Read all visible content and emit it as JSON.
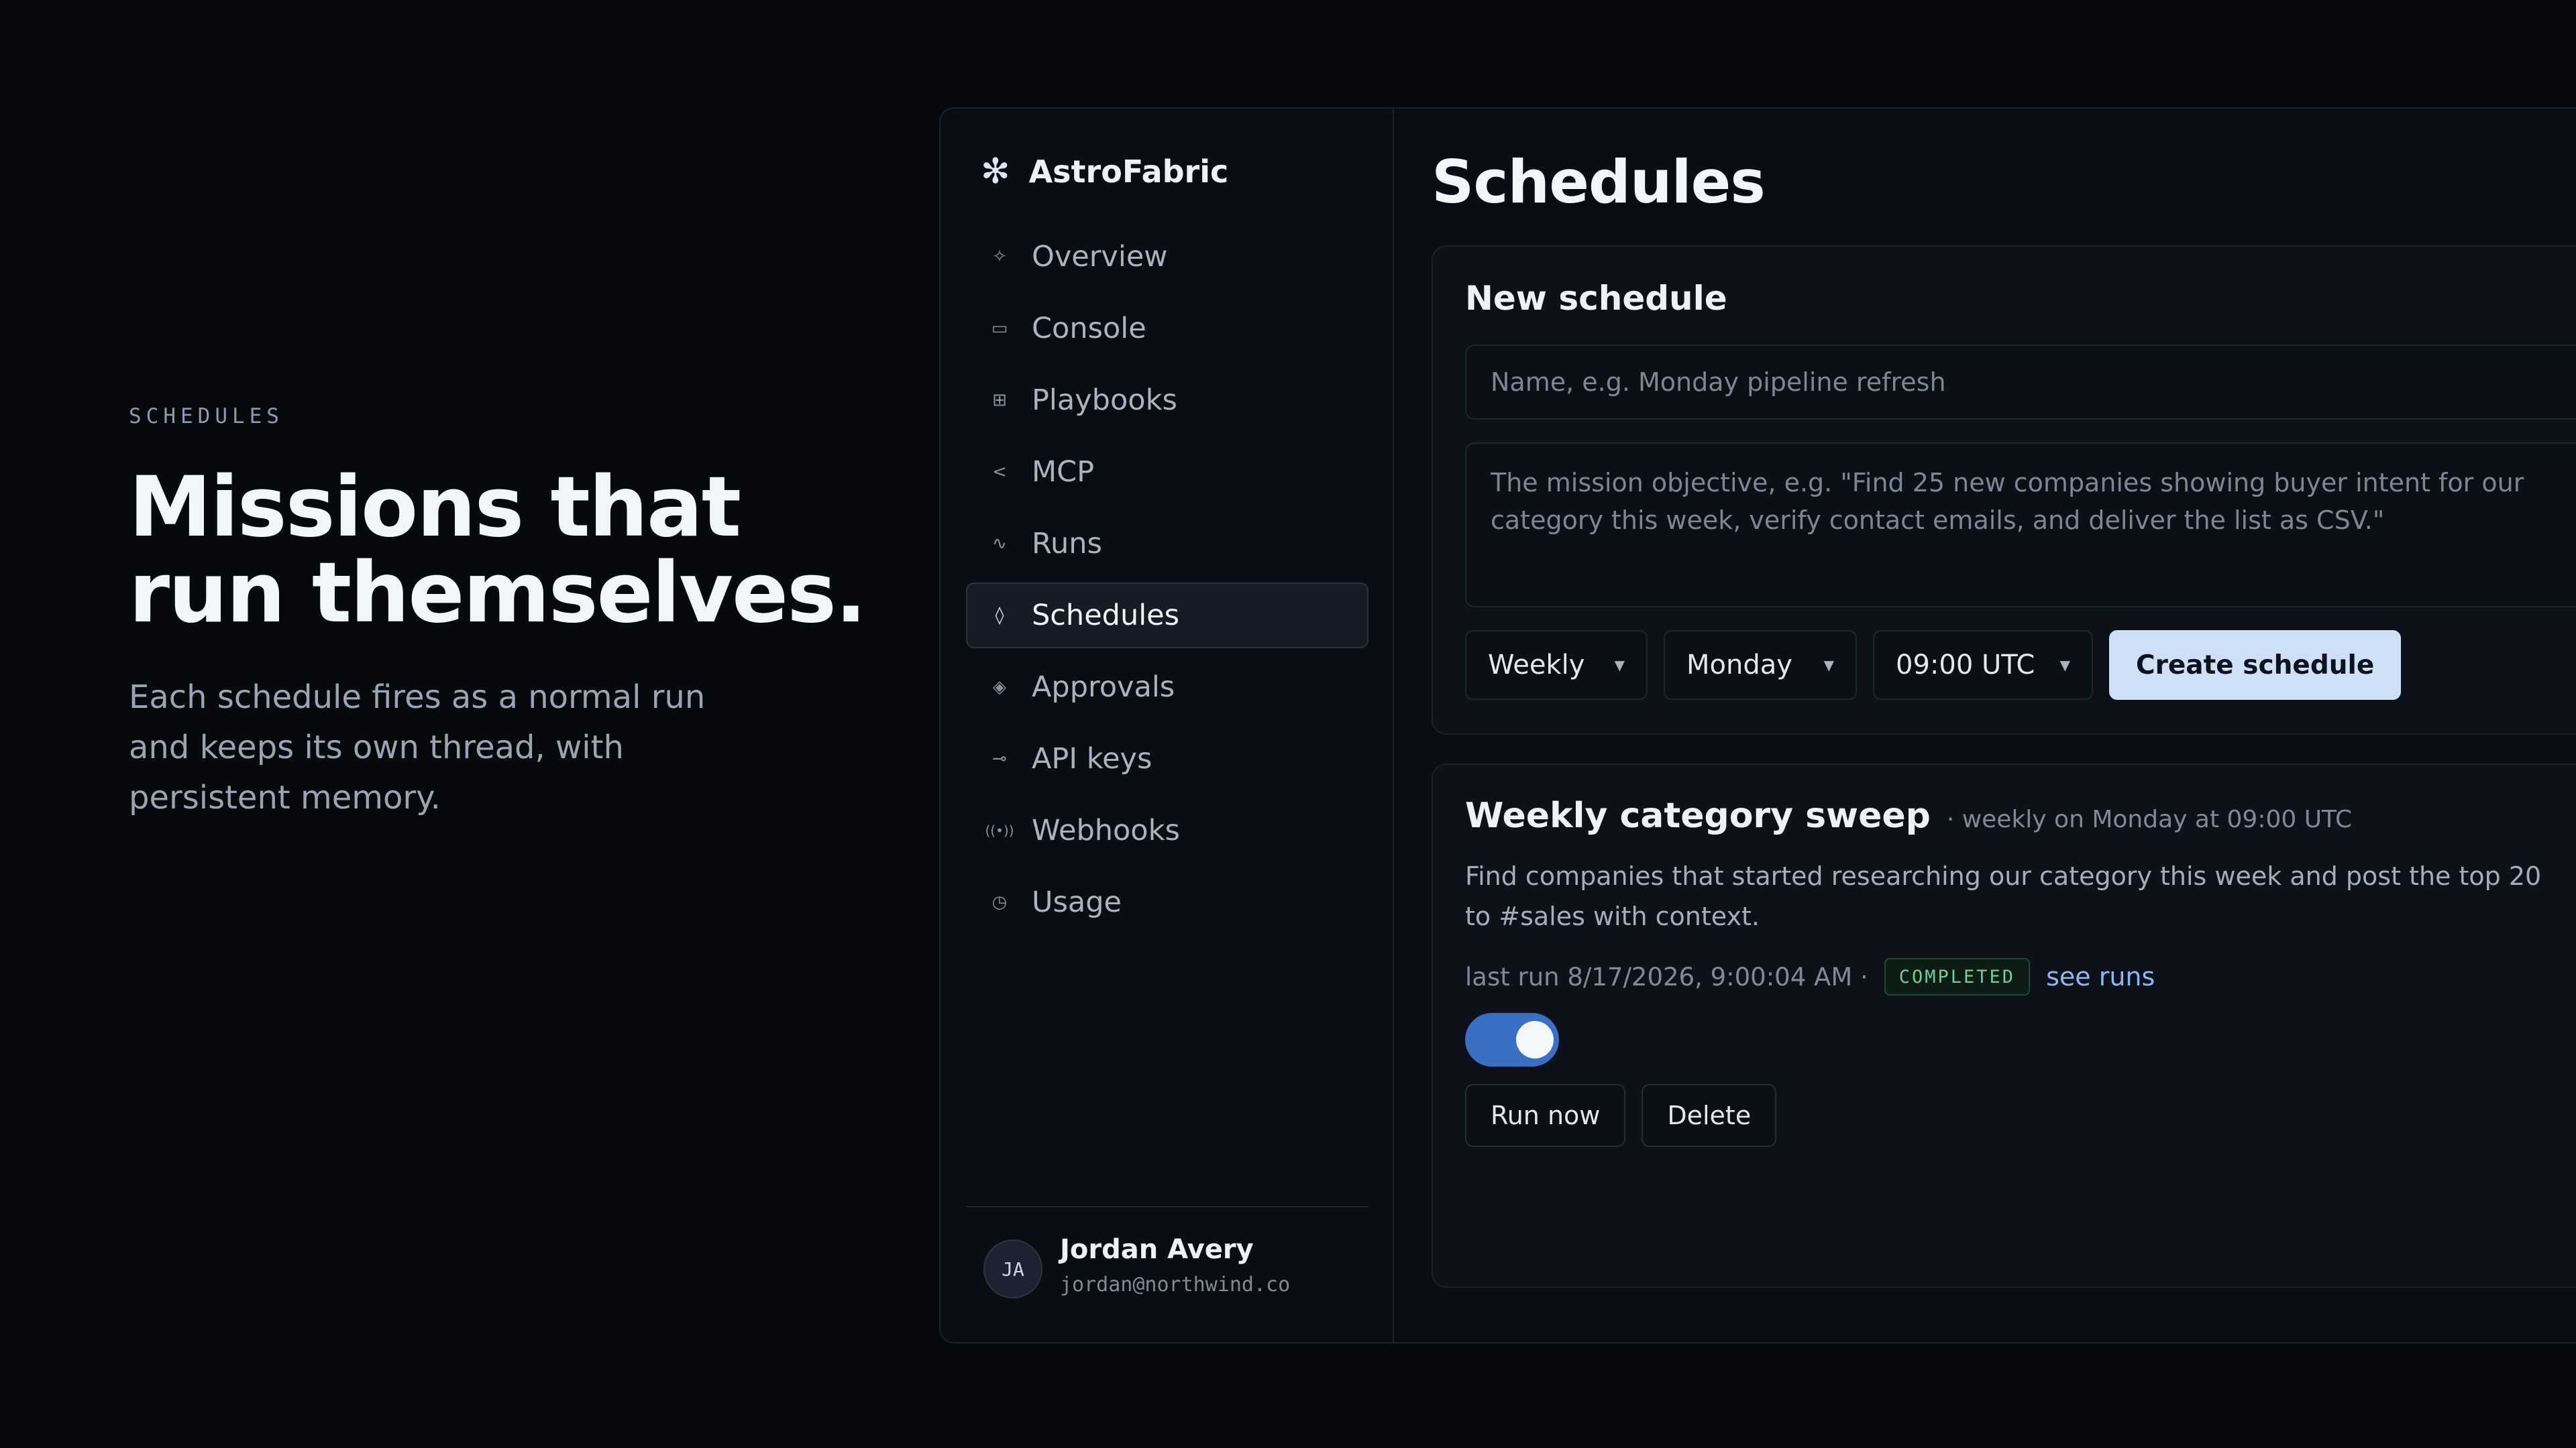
{
  "hero": {
    "eyebrow": "SCHEDULES",
    "title": "Missions that run themselves.",
    "subtitle": "Each schedule fires as a normal run and keeps its own thread, with persistent memory."
  },
  "app": {
    "brand": {
      "icon": "asterisk-icon",
      "name": "AstroFabric"
    },
    "nav": [
      {
        "label": "Overview",
        "icon": "sparkle-icon",
        "glyph": "✧"
      },
      {
        "label": "Console",
        "icon": "chat-icon",
        "glyph": "▭"
      },
      {
        "label": "Playbooks",
        "icon": "grid-icon",
        "glyph": "⊞"
      },
      {
        "label": "MCP",
        "icon": "share-icon",
        "glyph": "<"
      },
      {
        "label": "Runs",
        "icon": "activity-icon",
        "glyph": "∿"
      },
      {
        "label": "Schedules",
        "icon": "leaf-icon",
        "glyph": "◊"
      },
      {
        "label": "Approvals",
        "icon": "shield-icon",
        "glyph": "◈"
      },
      {
        "label": "API keys",
        "icon": "key-icon",
        "glyph": "⊸"
      },
      {
        "label": "Webhooks",
        "icon": "broadcast-icon",
        "glyph": "((•))"
      },
      {
        "label": "Usage",
        "icon": "clock-icon",
        "glyph": "◷"
      }
    ],
    "active_nav": "Schedules",
    "user": {
      "initials": "JA",
      "name": "Jordan Avery",
      "email": "jordan@northwind.co"
    }
  },
  "main": {
    "title": "Schedules",
    "new_schedule": {
      "title": "New schedule",
      "name_placeholder": "Name, e.g. Monday pipeline refresh",
      "objective_placeholder": "The mission objective, e.g. \"Find 25 new companies showing buyer intent for our category this week, verify contact emails, and deliver the list as CSV.\"",
      "frequency": "Weekly",
      "day": "Monday",
      "time": "09:00 UTC",
      "create_label": "Create schedule"
    },
    "schedule": {
      "name": "Weekly category sweep",
      "meta": "· weekly on Monday at 09:00 UTC",
      "description": "Find companies that started researching our category this week and post the top 20 to #sales with context.",
      "last_run": "last run 8/17/2026, 9:00:04 AM ·",
      "status": "COMPLETED",
      "see_runs": "see runs",
      "enabled": true,
      "run_now_label": "Run now",
      "delete_label": "Delete"
    }
  },
  "colors": {
    "background": "#07090d",
    "accent": "#cfe0f6",
    "toggle_on": "#3a6fc4",
    "status_completed": "#6fcf97",
    "link": "#8db7f2"
  }
}
